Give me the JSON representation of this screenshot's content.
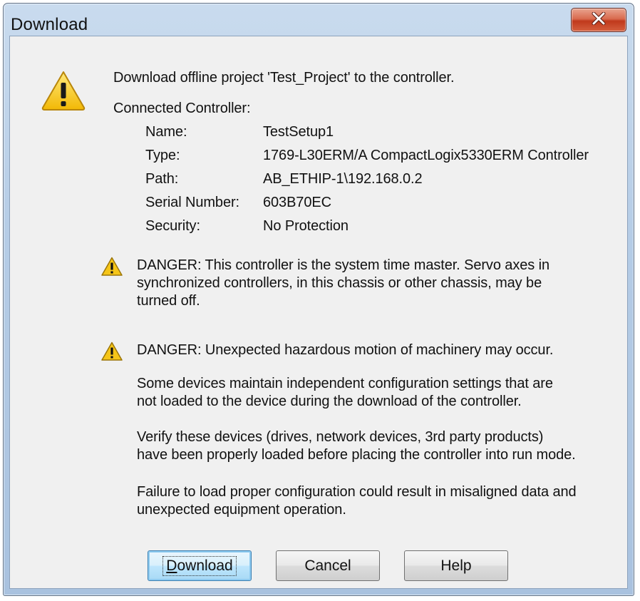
{
  "window": {
    "title": "Download",
    "close_icon": "close-x-icon",
    "colors": {
      "close_button": "#c7401f",
      "title_bar": "#b9cfe8",
      "client_bg": "#f0f0f0"
    }
  },
  "message": {
    "intro": "Download offline project 'Test_Project' to the controller.",
    "connected_heading": "Connected Controller:",
    "warning_icon": "warning-triangle-icon",
    "details": [
      {
        "label": "Name:",
        "value": "TestSetup1"
      },
      {
        "label": "Type:",
        "value": "1769-L30ERM/A CompactLogix5330ERM Controller"
      },
      {
        "label": "Path:",
        "value": "AB_ETHIP-1\\192.168.0.2"
      },
      {
        "label": "Serial Number:",
        "value": "603B70EC"
      },
      {
        "label": "Security:",
        "value": "No Protection"
      }
    ]
  },
  "danger1": {
    "lines": [
      "DANGER: This controller is the system time master.  Servo axes in",
      "synchronized controllers, in this chassis or other chassis, may be",
      "turned off."
    ]
  },
  "danger2": {
    "heading": "DANGER: Unexpected hazardous motion of machinery may occur.",
    "p1": [
      "Some devices maintain independent configuration settings that are",
      "not loaded to the device during the download of the controller."
    ],
    "p2": [
      "Verify these devices (drives, network devices, 3rd party products)",
      "have been properly loaded before placing the controller into run mode."
    ],
    "p3": [
      "Failure to load proper configuration could result in misaligned data and",
      "unexpected equipment operation."
    ]
  },
  "buttons": {
    "download_mnemonic": "D",
    "download_rest": "ownload",
    "cancel": "Cancel",
    "help": "Help"
  }
}
